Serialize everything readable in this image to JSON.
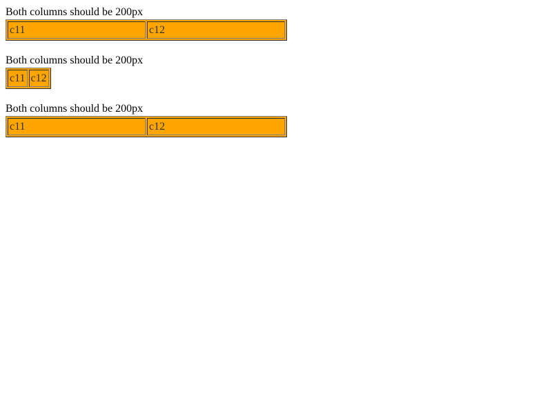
{
  "colors": {
    "cell_background": "#ffa500",
    "table_background": "#ffa500",
    "text": "#000000"
  },
  "sections": [
    {
      "caption": "Both columns should be 200px",
      "cells": [
        "c11",
        "c12"
      ]
    },
    {
      "caption": "Both columns should be 200px",
      "cells": [
        "c11",
        "c12"
      ]
    },
    {
      "caption": "Both columns should be 200px",
      "cells": [
        "c11",
        "c12"
      ]
    }
  ]
}
